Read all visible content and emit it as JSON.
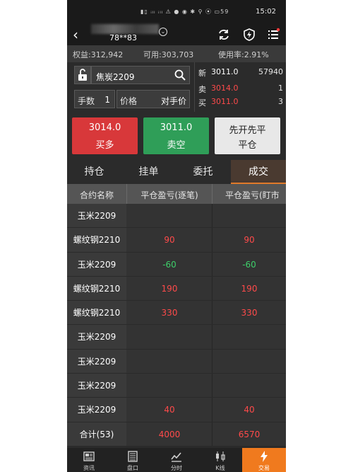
{
  "status_bar": {
    "time": "15:02",
    "battery": "59"
  },
  "header": {
    "account_id": "78**83"
  },
  "account": {
    "equity_label": "权益:",
    "equity": "312,942",
    "available_label": "可用:",
    "available": "303,703",
    "usage_label": "使用率:",
    "usage": "2.91%"
  },
  "order": {
    "symbol": "焦炭2209",
    "qty_label": "手数",
    "qty": "1",
    "price_label": "价格",
    "price_mode": "对手价"
  },
  "quotes": [
    {
      "label": "新",
      "price": "3011.0",
      "volume": "57940"
    },
    {
      "label": "卖",
      "price": "3014.0",
      "volume": "1"
    },
    {
      "label": "买",
      "price": "3011.0",
      "volume": "3"
    }
  ],
  "actions": {
    "buy_price": "3014.0",
    "buy_label": "买多",
    "sell_price": "3011.0",
    "sell_label": "卖空",
    "close_line1": "先开先平",
    "close_line2": "平仓"
  },
  "tabs": [
    "持仓",
    "挂单",
    "委托",
    "成交"
  ],
  "active_tab": 3,
  "table": {
    "headers": [
      "合约名称",
      "平仓盈亏(逐笔)",
      "平仓盈亏(盯市"
    ],
    "rows": [
      {
        "name": "玉米2209",
        "pnl_trade": "",
        "pnl_mark": "",
        "sign": ""
      },
      {
        "name": "螺纹钢2210",
        "pnl_trade": "90",
        "pnl_mark": "90",
        "sign": "pos"
      },
      {
        "name": "玉米2209",
        "pnl_trade": "-60",
        "pnl_mark": "-60",
        "sign": "neg"
      },
      {
        "name": "螺纹钢2210",
        "pnl_trade": "190",
        "pnl_mark": "190",
        "sign": "pos"
      },
      {
        "name": "螺纹钢2210",
        "pnl_trade": "330",
        "pnl_mark": "330",
        "sign": "pos"
      },
      {
        "name": "玉米2209",
        "pnl_trade": "",
        "pnl_mark": "",
        "sign": ""
      },
      {
        "name": "玉米2209",
        "pnl_trade": "",
        "pnl_mark": "",
        "sign": ""
      },
      {
        "name": "玉米2209",
        "pnl_trade": "",
        "pnl_mark": "",
        "sign": ""
      },
      {
        "name": "玉米2209",
        "pnl_trade": "40",
        "pnl_mark": "40",
        "sign": "pos"
      },
      {
        "name": "合计(53)",
        "pnl_trade": "4000",
        "pnl_mark": "6570",
        "sign": "pos"
      }
    ]
  },
  "bottom_nav": [
    {
      "label": "资讯",
      "icon": "news-icon"
    },
    {
      "label": "盘口",
      "icon": "order-book-icon"
    },
    {
      "label": "分时",
      "icon": "timeshare-chart-icon"
    },
    {
      "label": "K线",
      "icon": "candlestick-icon"
    },
    {
      "label": "交易",
      "icon": "lightning-icon"
    }
  ],
  "active_nav": 4,
  "colors": {
    "up": "#ff4a4a",
    "down": "#3ecf6a",
    "accent": "#f07a1e"
  }
}
